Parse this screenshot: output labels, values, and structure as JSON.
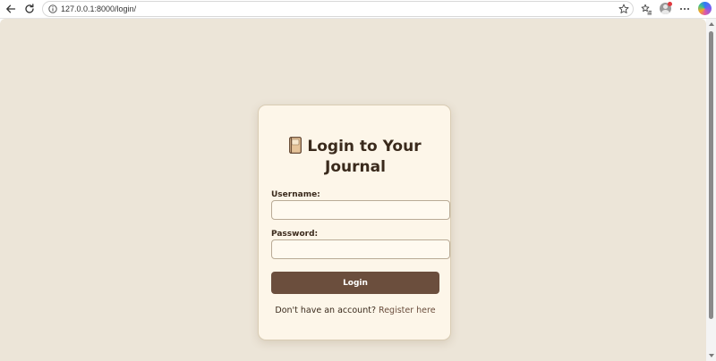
{
  "browser": {
    "url": "127.0.0.1:8000/login/",
    "icons": {
      "back": "arrow-left-icon",
      "reload": "reload-icon",
      "site_info": "info-icon",
      "bookmark": "star-icon",
      "favorites": "favorites-icon",
      "profile": "profile-avatar",
      "menu": "more-horizontal-icon",
      "copilot": "copilot-icon"
    },
    "profile_notification_color": "#e0383e"
  },
  "page": {
    "background_color": "#ece5d8",
    "card": {
      "background_color": "#fdf6e9",
      "title_icon": "journal-icon",
      "title": "Login to Your Journal",
      "username_label": "Username:",
      "username_value": "",
      "password_label": "Password:",
      "password_value": "",
      "login_button_label": "Login",
      "login_button_color": "#6b4e3d",
      "register_prompt": "Don't have an account?",
      "register_link": "Register here"
    }
  }
}
